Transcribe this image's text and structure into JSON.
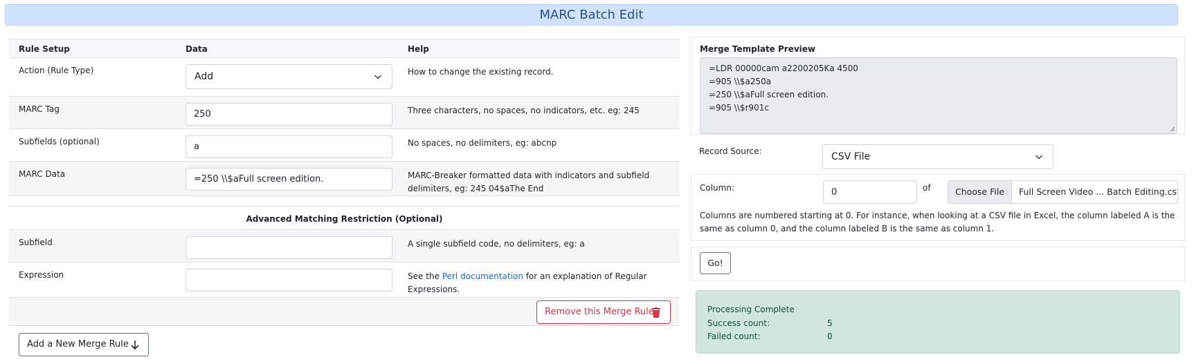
{
  "header": {
    "title": "MARC Batch Edit"
  },
  "rule_table": {
    "columns": [
      "Rule Setup",
      "Data",
      "Help"
    ],
    "rows": {
      "action": {
        "label": "Action (Rule Type)",
        "value": "Add",
        "help": "How to change the existing record."
      },
      "tag": {
        "label": "MARC Tag",
        "value": "250",
        "help": "Three characters, no spaces, no indicators, etc. eg: 245"
      },
      "subfields": {
        "label": "Subfields (optional)",
        "value": "a",
        "help": "No spaces, no delimiters, eg: abcnp"
      },
      "data": {
        "label": "MARC Data",
        "value": "=250 \\\\$aFull screen edition.",
        "help": "MARC-Breaker formatted data with indicators and subfield delimiters, eg: 245 04$aThe End"
      }
    },
    "advanced": {
      "title": "Advanced Matching Restriction (Optional)",
      "subfield": {
        "label": "Subfield",
        "value": "",
        "help": "A single subfield code, no delimiters, eg: a"
      },
      "expression": {
        "label": "Expression",
        "value": "",
        "help_prefix": "See the ",
        "help_link": "Perl documentation",
        "help_suffix": " for an explanation of Regular Expressions."
      }
    },
    "remove_button": "Remove this Merge Rule",
    "add_button": "Add a New Merge Rule"
  },
  "preview": {
    "title": "Merge Template Preview",
    "lines": "=LDR 00000cam a2200205Ka 4500\n=905 \\\\$a250a\n=250 \\\\$aFull screen edition.\n=905 \\\\$r901c"
  },
  "record_source": {
    "label": "Record Source:",
    "value": "CSV File"
  },
  "column": {
    "label": "Column:",
    "value": "0",
    "of_label": "of",
    "choose_file": "Choose File",
    "file_name": "Full Screen Video ... Batch Editing.csv",
    "help": "Columns are numbered starting at 0. For instance, when looking at a CSV file in Excel, the column labeled A is the same as column 0, and the column labeled B is the same as column 1."
  },
  "go_button": "Go!",
  "result": {
    "title": "Processing Complete",
    "success_label": "Success count:",
    "success_value": "5",
    "failed_label": "Failed count:",
    "failed_value": "0"
  },
  "colors": {
    "banner_bg": "#cfe2ff",
    "danger": "#dc3545",
    "success_bg": "#d1e7dd",
    "link": "#0d6efd"
  }
}
